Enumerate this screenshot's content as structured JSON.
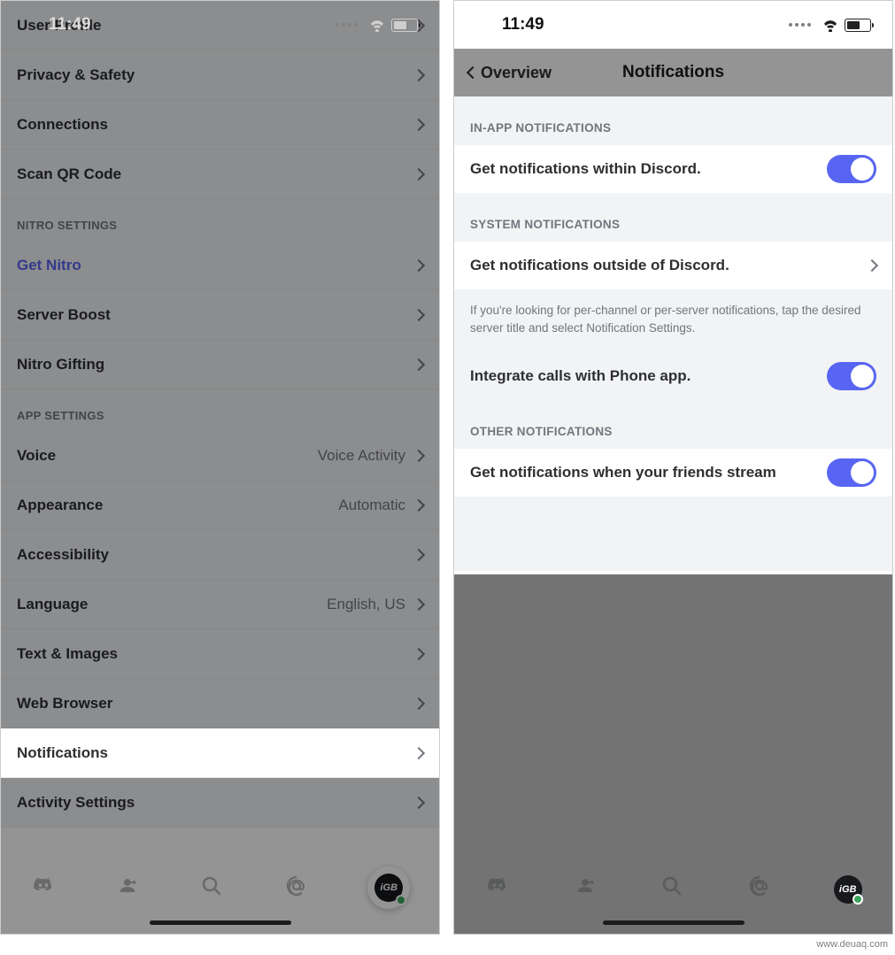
{
  "statusbar": {
    "time": "11:49"
  },
  "left": {
    "sections": [
      {
        "header": null,
        "rows": [
          {
            "label": "User Profile",
            "value": null
          },
          {
            "label": "Privacy & Safety",
            "value": null
          },
          {
            "label": "Connections",
            "value": null
          },
          {
            "label": "Scan QR Code",
            "value": null
          }
        ]
      },
      {
        "header": "NITRO SETTINGS",
        "rows": [
          {
            "label": "Get Nitro",
            "value": null,
            "nitro": true
          },
          {
            "label": "Server Boost",
            "value": null
          },
          {
            "label": "Nitro Gifting",
            "value": null
          }
        ]
      },
      {
        "header": "APP SETTINGS",
        "rows": [
          {
            "label": "Voice",
            "value": "Voice Activity"
          },
          {
            "label": "Appearance",
            "value": "Automatic"
          },
          {
            "label": "Accessibility",
            "value": null
          },
          {
            "label": "Language",
            "value": "English, US"
          },
          {
            "label": "Text & Images",
            "value": null
          },
          {
            "label": "Web Browser",
            "value": null
          },
          {
            "label": "Notifications",
            "value": null,
            "highlight": true
          },
          {
            "label": "Activity Settings",
            "value": null
          }
        ]
      }
    ],
    "avatar_text": "iGB"
  },
  "right": {
    "back": "Overview",
    "title": "Notifications",
    "s1_header": "IN-APP NOTIFICATIONS",
    "s1_row": "Get notifications within Discord.",
    "s2_header": "SYSTEM NOTIFICATIONS",
    "s2_row": "Get notifications outside of Discord.",
    "hint": "If you're looking for per-channel or per-server notifications, tap the desired server title and select Notification Settings.",
    "s2b_row": "Integrate calls with Phone app.",
    "s3_header": "OTHER NOTIFICATIONS",
    "s3_row": "Get notifications when your friends stream",
    "avatar_text": "iGB"
  },
  "watermark": "www.deuaq.com"
}
